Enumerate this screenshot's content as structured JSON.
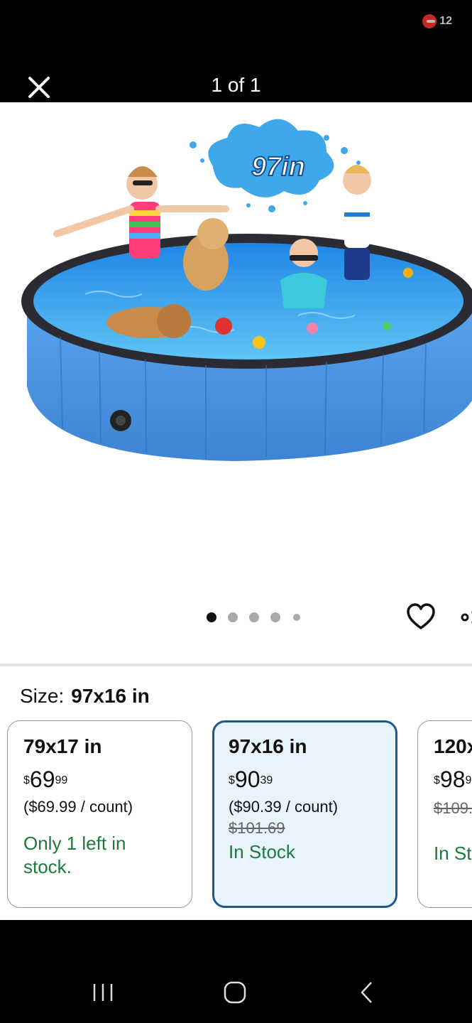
{
  "status_bar": {
    "notification_count": "12"
  },
  "viewer": {
    "counter": "1 of 1"
  },
  "hero_image": {
    "badge_text": "97in"
  },
  "carousel": {
    "count": 5,
    "active_index": 0
  },
  "size_selector": {
    "label": "Size:",
    "selected": "97x16 in",
    "options": [
      {
        "title": "79x17 in",
        "currency": "$",
        "price_whole": "69",
        "price_cents": "99",
        "unit_price": "($69.99 / count)",
        "list_price": "",
        "stock": "Only 1 left in stock."
      },
      {
        "title": "97x16 in",
        "currency": "$",
        "price_whole": "90",
        "price_cents": "39",
        "unit_price": "($90.39 / count)",
        "list_price": "$101.69",
        "stock": "In Stock"
      },
      {
        "title": "120x",
        "currency": "$",
        "price_whole": "98",
        "price_cents": "9",
        "unit_price": "",
        "list_price": "$109.",
        "stock": "In St"
      }
    ]
  },
  "colors": {
    "accent": "#1b5a8a",
    "selected_bg": "#e7f4fb",
    "in_stock": "#1e7a3a",
    "pool": "#4a93e0"
  }
}
